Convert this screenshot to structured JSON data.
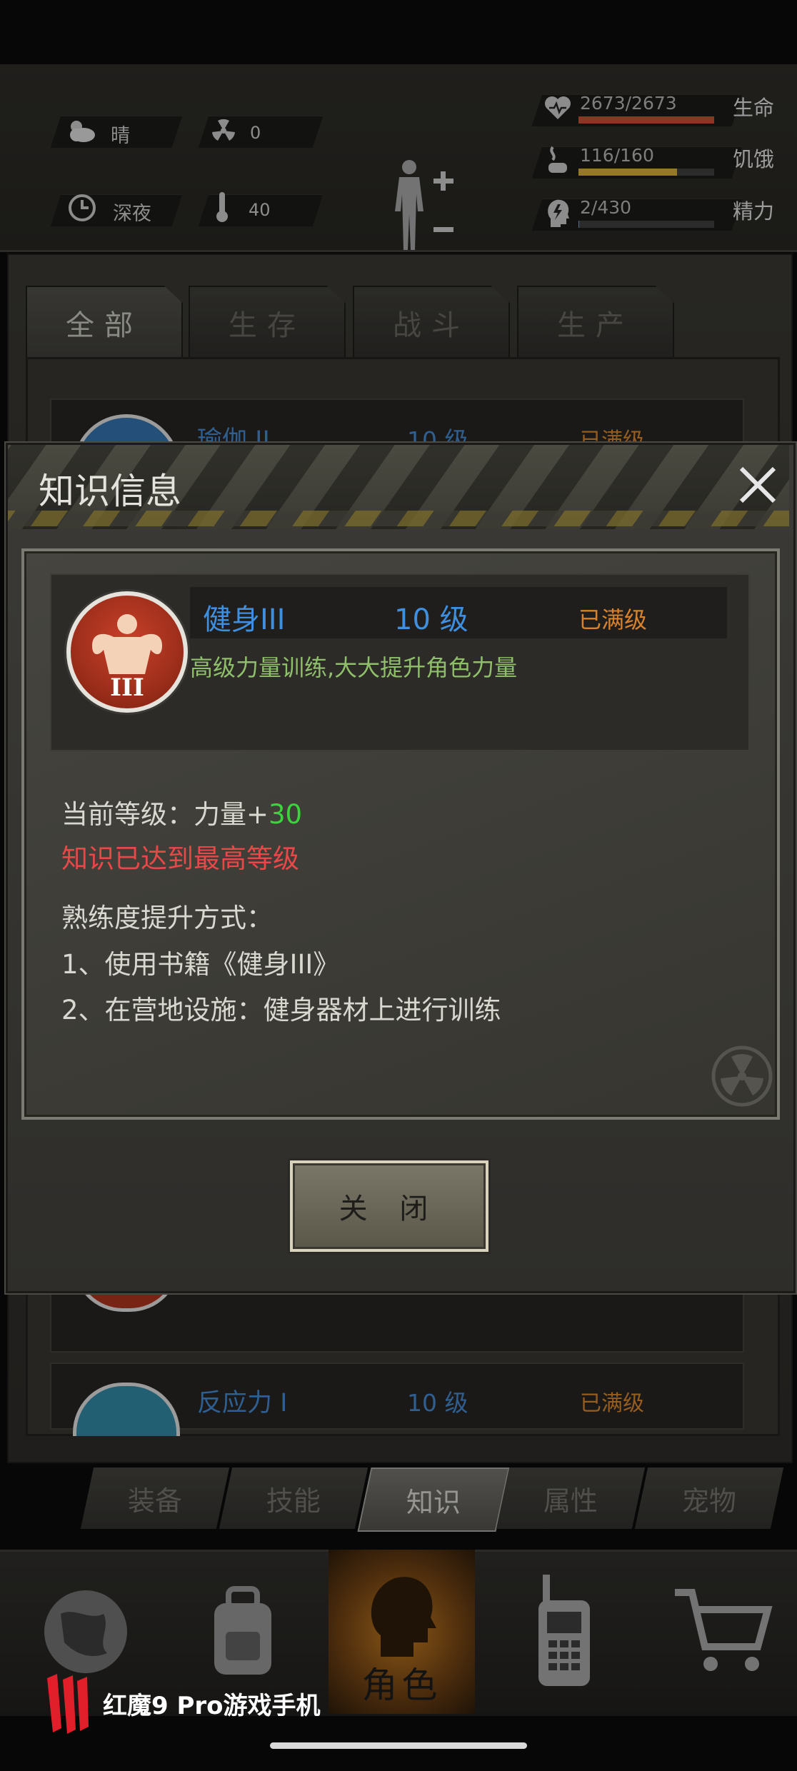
{
  "status": {
    "weather": "晴",
    "radiation": "0",
    "time_of_day": "深夜",
    "temperature": "40",
    "life": {
      "label": "生命",
      "value": "2673/2673",
      "fraction": 1.0,
      "color": "#b94a30"
    },
    "hunger": {
      "label": "饥饿",
      "value": "116/160",
      "fraction": 0.725,
      "color": "#c9a13a"
    },
    "energy": {
      "label": "精力",
      "value": "2/430",
      "fraction": 0.005,
      "color": "#6e8fb8"
    }
  },
  "category_tabs": [
    "全部",
    "生存",
    "战斗",
    "生产"
  ],
  "list_rows": [
    {
      "title": "瑜伽 II",
      "level": "10 级",
      "status": "已满级"
    },
    {
      "title": "反应力 I",
      "level": "10 级",
      "status": "已满级"
    }
  ],
  "dialog": {
    "title": "知识信息",
    "skill": {
      "name": "健身III",
      "level": "10 级",
      "status": "已满级",
      "description": "高级力量训练,大大提升角色力量",
      "icon_numeral": "III"
    },
    "current_level_label": "当前等级：力量+",
    "current_level_value": "30",
    "max_note": "知识已达到最高等级",
    "methods_title": "熟练度提升方式：",
    "methods": [
      "1、使用书籍《健身III》",
      "2、在营地设施：健身器材上进行训练"
    ],
    "close_label": "关 闭"
  },
  "sub_tabs": [
    "装备",
    "技能",
    "知识",
    "属性",
    "宠物"
  ],
  "active_sub_tab": "知识",
  "nav": {
    "character_label": "角色"
  },
  "brand": "红魔9 Pro游戏手机"
}
